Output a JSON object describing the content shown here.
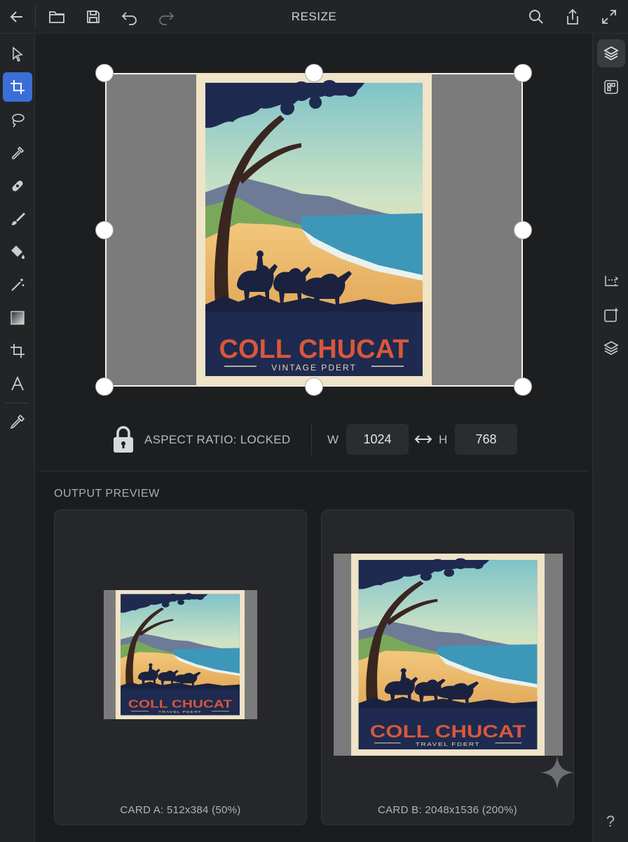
{
  "toolbar": {
    "title": "RESIZE",
    "icons": [
      "back-arrow-icon",
      "folder-icon",
      "save-icon",
      "undo-icon",
      "redo-icon",
      "search-icon",
      "share-icon",
      "expand-icon"
    ]
  },
  "left_tools": [
    "select-arrow-icon",
    "crop-icon",
    "lasso-icon",
    "eyedropper-icon",
    "healing-bandage-icon",
    "brush-icon",
    "fill-bucket-icon",
    "magic-wand-icon",
    "gradient-icon",
    "crop-icon",
    "text-icon",
    "color-picker-icon"
  ],
  "active_tool": "crop-icon",
  "right_panel": [
    "layers-icon",
    "adjustments-icon",
    "transform-icon",
    "new-layer-icon",
    "layers-stack-icon"
  ],
  "canvas": {
    "poster_title": "COLL CHUCAT",
    "poster_subtitle": "VINTAGE PDERT"
  },
  "aspect": {
    "label": "ASPECT RATIO: LOCKED",
    "w_label": "W",
    "w_value": "1024",
    "h_label": "H",
    "h_value": "768"
  },
  "preview": {
    "section_title": "OUTPUT PREVIEW",
    "cards": [
      {
        "caption": "CARD A: 512x384 (50%)",
        "poster_title": "COLL CHUCAT",
        "poster_subtitle": "TRAVEL PDERT"
      },
      {
        "caption": "CARD B: 2048x1536 (200%)",
        "poster_title": "COLL CHUCAT",
        "poster_subtitle": "TRAVEL FDERT"
      }
    ]
  },
  "help_label": "?",
  "colors": {
    "accent": "#3a6fd8",
    "background": "#1b1c1d",
    "panel": "#232425",
    "poster_title": "#d9573c",
    "poster_navy": "#1e2a4f",
    "poster_cream": "#efe3c8"
  }
}
